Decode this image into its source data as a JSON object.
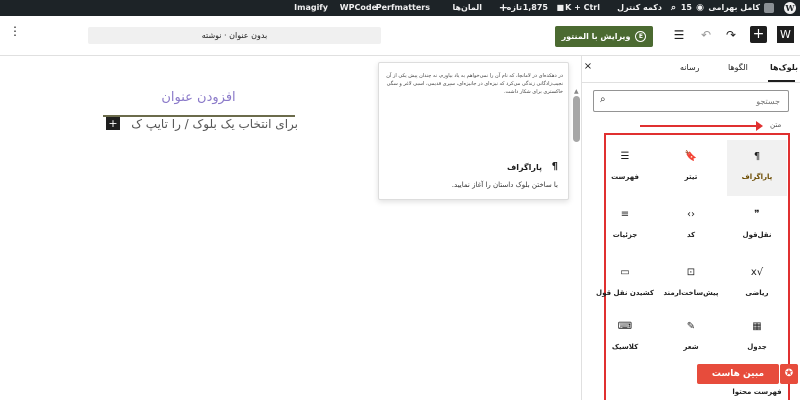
{
  "admin_bar": {
    "wp_logo": "W",
    "user": "کامل بهرامی",
    "count_15": "15",
    "dashboard": "دکمه کنترل",
    "shortcut": "K + Ctrl",
    "comments_count": "1,875",
    "new": "تازه",
    "lang": "المان‌ها",
    "perfmatters": "Perfmatters",
    "wpcode": "WPCode",
    "imagify": "Imagify"
  },
  "toolbar": {
    "publish": "ویرایش با المنتور",
    "publish_icon": "E",
    "title_box": "بدون عنوان · نوشته",
    "icons": {
      "menu": "menu-icon",
      "list": "list-view-icon",
      "undo": "undo-icon",
      "redo": "redo-icon",
      "add": "add-block-icon",
      "wp": "wp-logo-icon"
    }
  },
  "canvas": {
    "title_placeholder": "افزودن عنوان",
    "hint": "برای انتخاب یک بلوک / را تایپ ک"
  },
  "popover": {
    "preview": "در دهکده‌ای در لامانچا، که نام آن را نمی‌خواهم به یاد بیاورم، نه چندان پیش یکی از آن نجیب‌زادگانی زندگی می‌کرد که نیزه‌ای در جانیزه‌ای، سپری قدیمی، اسبی لاغر و سگی خاکستری برای شکار داشت.",
    "title": "پاراگراف",
    "icon": "¶",
    "description": "با ساختن بلوک داستان را آغاز نمایید."
  },
  "inserter": {
    "tabs": [
      "بلوک‌ها",
      "الگوها",
      "رسانه"
    ],
    "close": "×",
    "search_placeholder": "جستجو",
    "category": "متن",
    "blocks": [
      {
        "label": "پاراگراف",
        "icon": "¶",
        "name": "paragraph"
      },
      {
        "label": "تیتر",
        "icon": "🔖",
        "name": "heading"
      },
      {
        "label": "فهرست",
        "icon": "☰",
        "name": "list"
      },
      {
        "label": "نقل‌قول",
        "icon": "❞",
        "name": "quote"
      },
      {
        "label": "کد",
        "icon": "‹›",
        "name": "code"
      },
      {
        "label": "جزئیات",
        "icon": "≡",
        "name": "details"
      },
      {
        "label": "ریاضی",
        "icon": "√x",
        "name": "math"
      },
      {
        "label": "پیش‌ساخت‌ارمند",
        "icon": "⊡",
        "name": "preformatted"
      },
      {
        "label": "کشیدن نقل قول",
        "icon": "▭",
        "name": "pullquote"
      },
      {
        "label": "جدول",
        "icon": "▦",
        "name": "table"
      },
      {
        "label": "شعر",
        "icon": "✎",
        "name": "verse"
      },
      {
        "label": "کلاسیک",
        "icon": "⌨",
        "name": "classic"
      }
    ],
    "more_block": "فهرست محتوا"
  },
  "watermark": {
    "text": "مبین هاست",
    "icon": "✪"
  },
  "colors": {
    "accent": "#e03030",
    "publish": "#4b6a31",
    "title": "#8a79c9"
  }
}
